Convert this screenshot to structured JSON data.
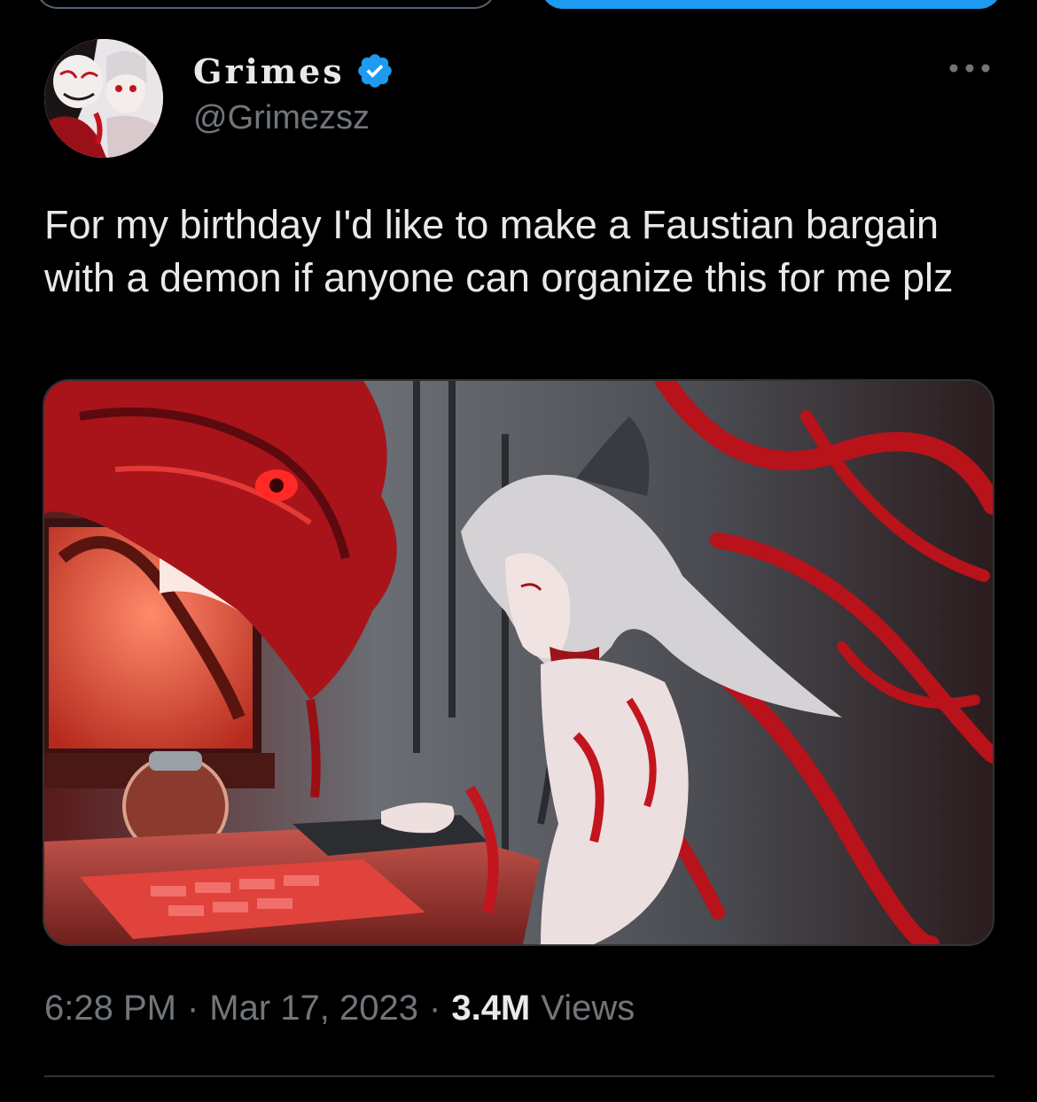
{
  "author": {
    "display_name": "Grimes",
    "handle": "@Grimezsz",
    "avatar_icon": "profile-avatar"
  },
  "tweet": {
    "text": "For my birthday I'd like to make a Faustian bargain with a demon if anyone can organize this for me plz",
    "media_alt": "",
    "time": "6:28 PM",
    "separator": "·",
    "date": "Mar 17, 2023",
    "views_count": "3.4M",
    "views_label": "Views"
  },
  "icons": {
    "verified": "verified-badge-icon",
    "more": "more-options-icon"
  },
  "colors": {
    "background": "#000000",
    "text_primary": "#e7e9ea",
    "text_secondary": "#71767b",
    "accent": "#1d9bf0",
    "divider": "#2f3336"
  }
}
